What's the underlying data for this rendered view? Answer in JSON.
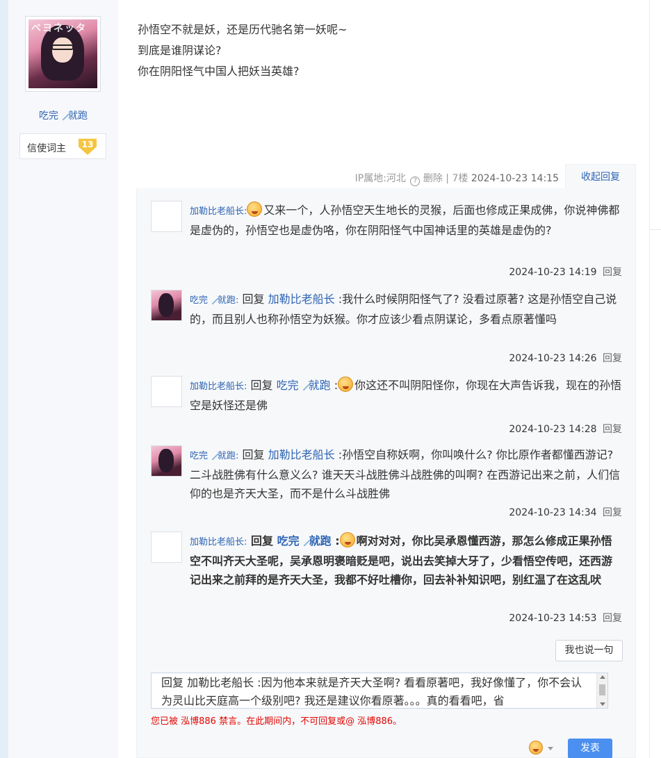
{
  "author": {
    "avatar_text": "ベヨネッタ",
    "name_part1": "吃完",
    "name_part2": "就跑",
    "badge_label": "信使词主",
    "badge_level": "13"
  },
  "post": {
    "lines": [
      "孙悟空不就是妖，还是历代驰名第一妖呢~",
      "到底是谁阴谋论?",
      "你在阴阳怪气中国人把妖当英雄?"
    ],
    "meta": {
      "ip": "IP属地:河北",
      "help_icon": "?",
      "delete": "删除",
      "sep": "|",
      "floor": "7楼",
      "time": "2024-10-23 14:15"
    },
    "collapse_label": "收起回复"
  },
  "replies": [
    {
      "user": "加勒比老船长",
      "colon": ":",
      "has_reply_to": false,
      "reply_word": "",
      "reply_to_1": "",
      "reply_to_2": "",
      "reply_colon": "",
      "emoji": "angry-face",
      "text": "又来一个，人孙悟空天生地长的灵猴，后面也修成正果成佛，你说神佛都是虚伪的，孙悟空也是虚伪咯，你在阴阳怪气中国神话里的英雄是虚伪的?",
      "time": "2024-10-23 14:19",
      "reply_label": "回复"
    },
    {
      "user_part1": "吃完",
      "user_part2": "就跑",
      "colon": ":",
      "reply_word": "回复",
      "reply_to": "加勒比老船长",
      "reply_colon": ":",
      "text": "我什么时候阴阳怪气了? 没看过原著? 这是孙悟空自己说的，而且别人也称孙悟空为妖猴。你才应该少看点阴谋论，多看点原著懂吗",
      "time": "2024-10-23 14:26",
      "reply_label": "回复"
    },
    {
      "user": "加勒比老船长",
      "colon": ":",
      "reply_word": "回复",
      "reply_to_1": "吃完",
      "reply_to_2": "就跑",
      "reply_colon": ":",
      "emoji": "angry-face",
      "text": "你这还不叫阴阳怪你，你现在大声告诉我，现在的孙悟空是妖怪还是佛",
      "time": "2024-10-23 14:28",
      "reply_label": "回复"
    },
    {
      "user_part1": "吃完",
      "user_part2": "就跑",
      "colon": ":",
      "reply_word": "回复",
      "reply_to": "加勒比老船长",
      "reply_colon": ":",
      "text": "孙悟空自称妖啊，你叫唤什么? 你比原作者都懂西游记? 二斗战胜佛有什么意义么? 谁天天斗战胜佛斗战胜佛的叫啊? 在西游记出来之前，人们信仰的也是齐天大圣，而不是什么斗战胜佛",
      "time": "2024-10-23 14:34",
      "reply_label": "回复"
    },
    {
      "user": "加勒比老船长",
      "colon": ":",
      "reply_word": "回复",
      "reply_to_1": "吃完",
      "reply_to_2": "就跑",
      "reply_colon": ":",
      "emoji": "angry-face",
      "text": "啊对对对，你比吴承恩懂西游，那怎么修成正果孙悟空不叫齐天大圣呢，吴承恩明褒暗贬是吧，说出去笑掉大牙了，少看悟空传吧，还西游记出来之前拜的是齐天大圣，我都不好吐槽你，回去补补知识吧，别红温了在这乱吠",
      "time": "2024-10-23 14:53",
      "reply_label": "回复"
    }
  ],
  "say_button": "我也说一句",
  "editor": {
    "text": "回复 加勒比老船长 :因为他本来就是齐天大圣啊? 看看原著吧，我好像懂了，你不会认为灵山比天庭高一个级别吧? 我还是建议你看原著。。。真的看看吧，省"
  },
  "ban_notice": "您已被 泓博886 禁言。在此期间内，不可回复或@ 泓博886。",
  "submit_label": "发表",
  "colors": {
    "link": "#2d64b3",
    "notice": "#e10602",
    "submit_bg": "#4b8ff0",
    "sidebar_bg": "#f6f8fb",
    "reply_bg": "#f7f8fa"
  }
}
